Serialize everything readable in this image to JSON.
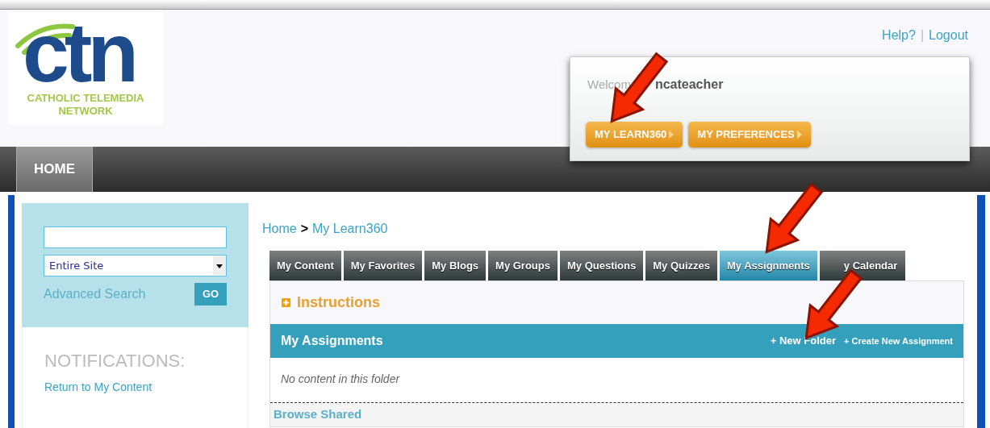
{
  "header": {
    "logo": {
      "mark": "ctn",
      "lines": [
        "CATHOLIC TELEMEDIA",
        "NETWORK"
      ]
    },
    "links": [
      "Help?",
      "Logout"
    ],
    "separator": "|"
  },
  "welcome": {
    "greeting": "Welcom",
    "user": "ncateacher",
    "buttons": [
      "MY LEARN360",
      "MY PREFERENCES"
    ]
  },
  "nav": [
    {
      "label": "HOME",
      "selected": true
    }
  ],
  "sidebar": {
    "scope": "Entire Site",
    "advanced": "Advanced Search",
    "go": "GO",
    "notifications_title": "NOTIFICATIONS:",
    "link": "Return to My Content"
  },
  "breadcrumb": {
    "items": [
      "Home",
      "My Learn360"
    ],
    "separator": ">"
  },
  "tabs": [
    {
      "label": "My Content",
      "selected": false
    },
    {
      "label": "My Favorites",
      "selected": false
    },
    {
      "label": "My Blogs",
      "selected": false
    },
    {
      "label": "My Groups",
      "selected": false
    },
    {
      "label": "My Questions",
      "selected": false
    },
    {
      "label": "My Quizzes",
      "selected": false
    },
    {
      "label": "My Assignments",
      "selected": true
    },
    {
      "label": "y Calendar",
      "selected": false
    }
  ],
  "panel": {
    "instructions": "Instructions",
    "expanded": false,
    "title": "My Assignments",
    "actions": [
      "+ New Folder",
      "+ Create New Assignment"
    ],
    "empty": "No content in this folder",
    "footer": "Browse Shared"
  }
}
